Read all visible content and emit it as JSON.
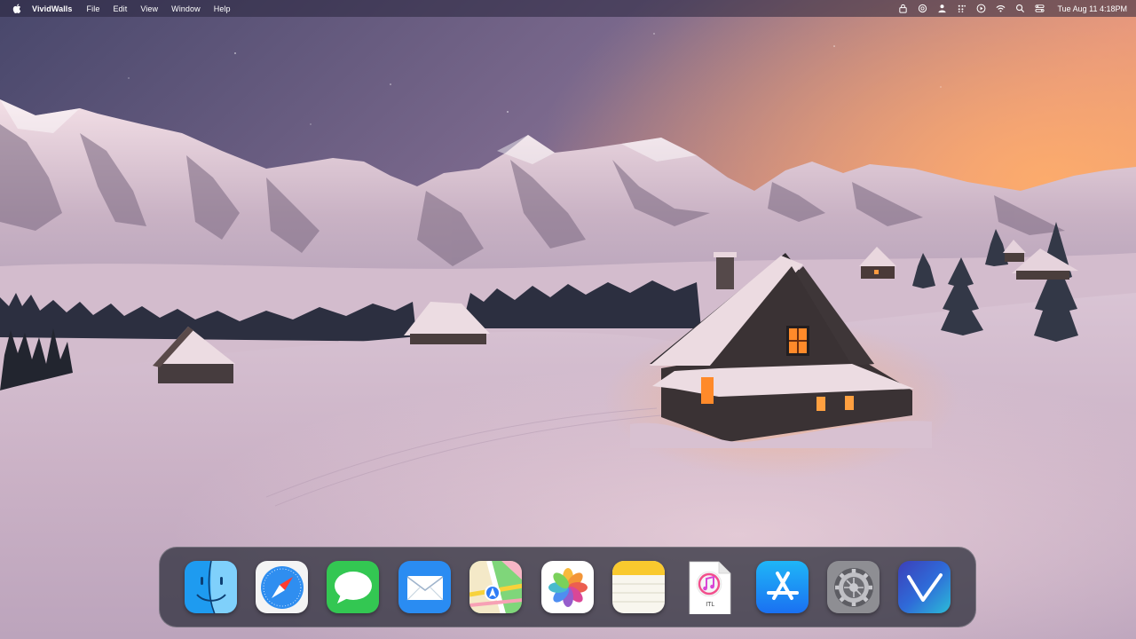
{
  "menubar": {
    "app_name": "VividWalls",
    "menus": [
      "File",
      "Edit",
      "View",
      "Window",
      "Help"
    ],
    "status_icons": [
      "lock-icon",
      "chatgpt-icon",
      "user-icon",
      "grid-dots-icon",
      "play-circle-icon",
      "wifi-icon",
      "search-icon",
      "control-center-icon"
    ],
    "clock": "Tue Aug 11  4:18PM"
  },
  "dock": {
    "apps": [
      {
        "name": "Finder",
        "icon": "finder-icon"
      },
      {
        "name": "Safari",
        "icon": "safari-icon"
      },
      {
        "name": "Messages",
        "icon": "messages-icon"
      },
      {
        "name": "Mail",
        "icon": "mail-icon"
      },
      {
        "name": "Maps",
        "icon": "maps-icon"
      },
      {
        "name": "Photos",
        "icon": "photos-icon"
      },
      {
        "name": "Notes",
        "icon": "notes-icon"
      },
      {
        "name": "ITL",
        "icon": "itl-file-icon",
        "label": "ITL"
      },
      {
        "name": "App Store",
        "icon": "app-store-icon"
      },
      {
        "name": "System Settings",
        "icon": "settings-gear-icon"
      },
      {
        "name": "VividWalls",
        "icon": "vividwalls-icon"
      }
    ]
  },
  "colors": {
    "sky_top": "#4a4a6e",
    "sky_glow": "#f49a6a",
    "snow": "#dcc4d2",
    "cabin": "#3a3236",
    "window_light": "#ff8a2a"
  }
}
